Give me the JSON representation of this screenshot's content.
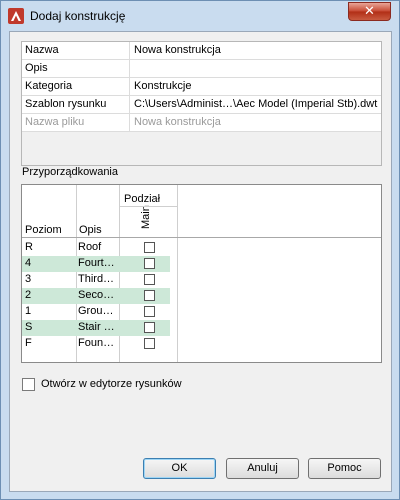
{
  "window": {
    "title": "Dodaj konstrukcję",
    "close_glyph": "✕",
    "icon": "autocad-app-icon",
    "accent": "#c74a34"
  },
  "properties": [
    {
      "name": "Nazwa",
      "value": "Nowa konstrukcja",
      "disabled": false
    },
    {
      "name": "Opis",
      "value": "",
      "disabled": false
    },
    {
      "name": "Kategoria",
      "value": "Konstrukcje",
      "disabled": false
    },
    {
      "name": "Szablon rysunku",
      "value": "C:\\Users\\Administ…\\Aec Model (Imperial Stb).dwt",
      "disabled": false
    },
    {
      "name": "Nazwa pliku",
      "value": "Nowa konstrukcja",
      "disabled": true
    }
  ],
  "assignments": {
    "label": "Przyporządkowania",
    "group_header": "Podział",
    "division_column": "Main",
    "headers": {
      "level": "Poziom",
      "description": "Opis"
    },
    "rows": [
      {
        "level": "R",
        "description": "Roof",
        "checked": false
      },
      {
        "level": "4",
        "description": "Fourt…",
        "checked": false
      },
      {
        "level": "3",
        "description": "Third…",
        "checked": false
      },
      {
        "level": "2",
        "description": "Seco…",
        "checked": false
      },
      {
        "level": "1",
        "description": "Grou…",
        "checked": false
      },
      {
        "level": "S",
        "description": "Stair …",
        "checked": false
      },
      {
        "level": "F",
        "description": "Foun…",
        "checked": false
      }
    ]
  },
  "open_in_editor": {
    "label": "Otwórz w edytorze rysunków",
    "checked": false
  },
  "buttons": {
    "ok": "OK",
    "cancel": "Anuluj",
    "help": "Pomoc"
  }
}
